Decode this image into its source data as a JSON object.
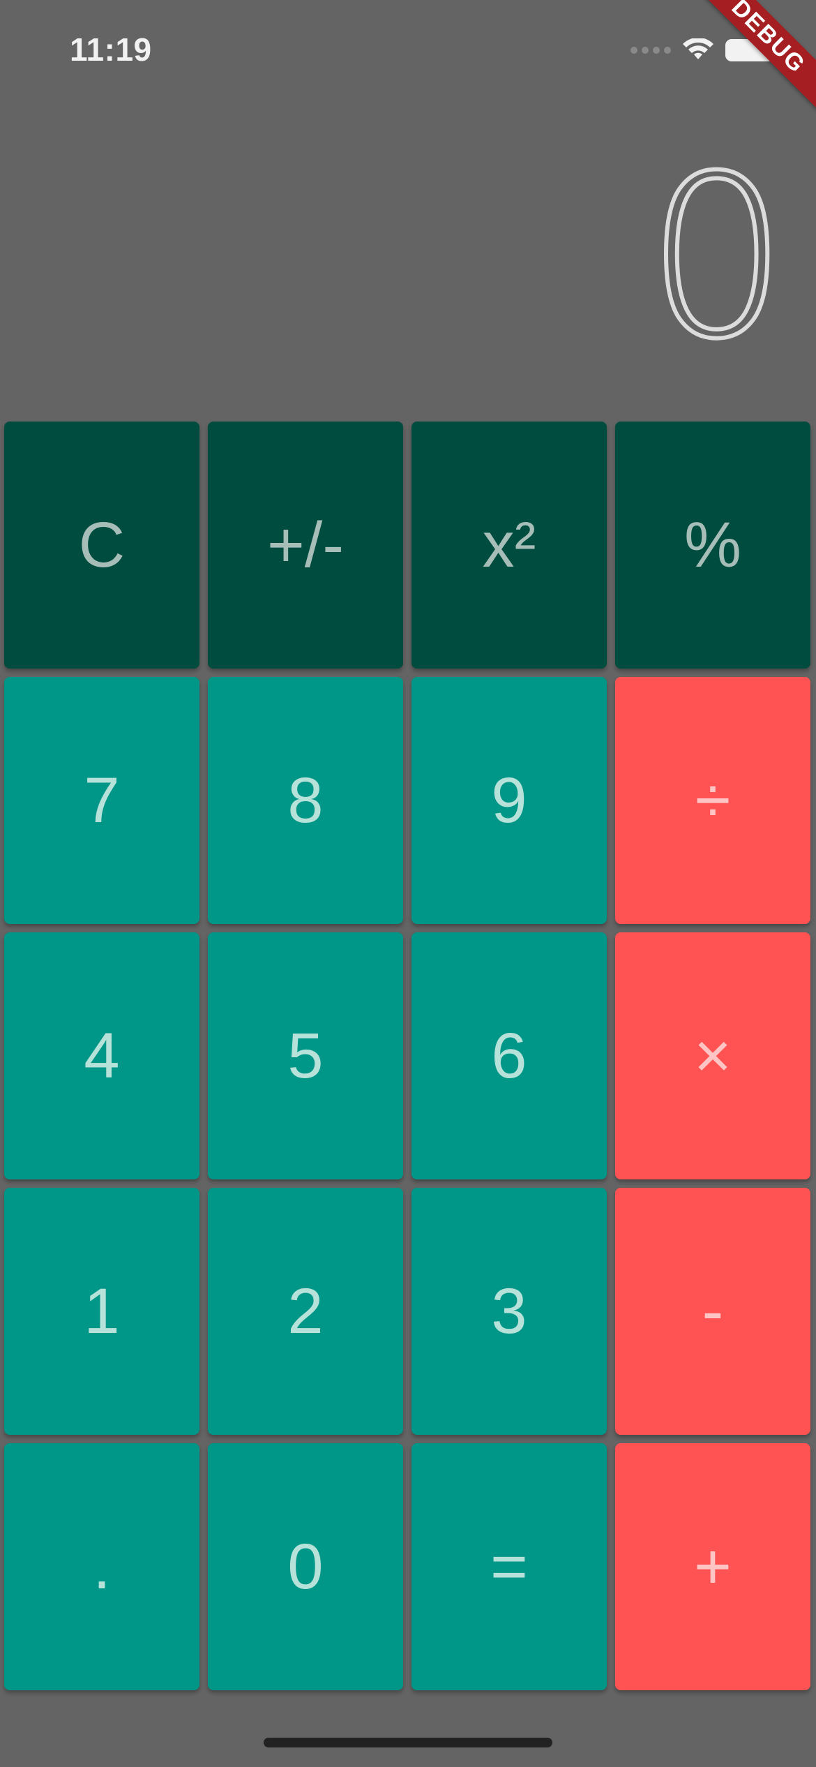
{
  "status_bar": {
    "time": "11:19",
    "icons": [
      "signal-dots-icon",
      "wifi-icon",
      "battery-icon"
    ]
  },
  "debug_banner": "DEBUG",
  "display": {
    "value": "0"
  },
  "keys": [
    {
      "label": "C",
      "kind": "fn",
      "name": "clear-button"
    },
    {
      "label": "+/-",
      "kind": "fn",
      "name": "negate-button"
    },
    {
      "label": "x²",
      "kind": "fn",
      "name": "square-button"
    },
    {
      "label": "%",
      "kind": "fn",
      "name": "percent-button"
    },
    {
      "label": "7",
      "kind": "num",
      "name": "digit-7-button"
    },
    {
      "label": "8",
      "kind": "num",
      "name": "digit-8-button"
    },
    {
      "label": "9",
      "kind": "num",
      "name": "digit-9-button"
    },
    {
      "label": "÷",
      "kind": "op",
      "name": "divide-button"
    },
    {
      "label": "4",
      "kind": "num",
      "name": "digit-4-button"
    },
    {
      "label": "5",
      "kind": "num",
      "name": "digit-5-button"
    },
    {
      "label": "6",
      "kind": "num",
      "name": "digit-6-button"
    },
    {
      "label": "×",
      "kind": "op",
      "name": "multiply-button"
    },
    {
      "label": "1",
      "kind": "num",
      "name": "digit-1-button"
    },
    {
      "label": "2",
      "kind": "num",
      "name": "digit-2-button"
    },
    {
      "label": "3",
      "kind": "num",
      "name": "digit-3-button"
    },
    {
      "label": "-",
      "kind": "op",
      "name": "subtract-button"
    },
    {
      "label": ".",
      "kind": "num",
      "name": "decimal-button"
    },
    {
      "label": "0",
      "kind": "num",
      "name": "digit-0-button"
    },
    {
      "label": "=",
      "kind": "num",
      "name": "equals-button"
    },
    {
      "label": "+",
      "kind": "op",
      "name": "add-button"
    }
  ],
  "colors": {
    "background": "#646464",
    "function_key": "#004d40",
    "number_key": "#009688",
    "operator_key": "#ff5353",
    "debug_ribbon": "#a41e22"
  }
}
